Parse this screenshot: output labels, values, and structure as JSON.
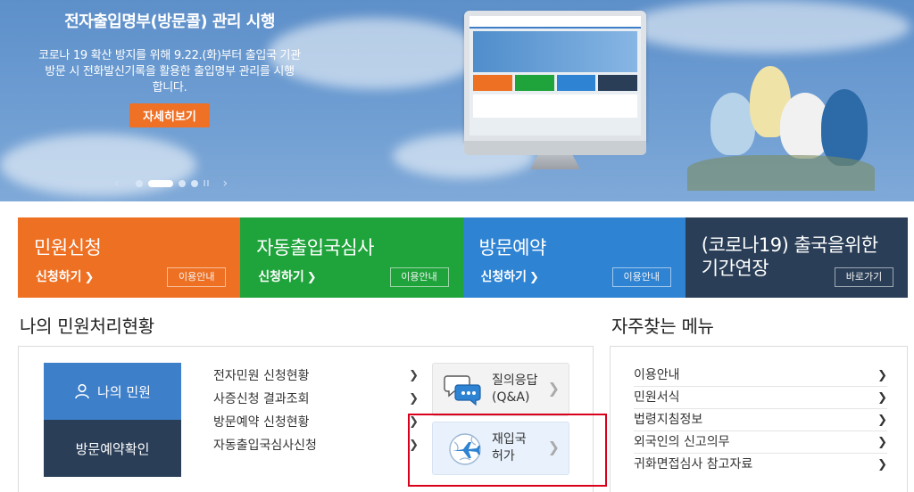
{
  "hero": {
    "title": "전자출입명부(방문콜) 관리 시행",
    "desc_line1": "코로나 19 확산 방지를 위해 9.22.(화)부터 출입국 기관",
    "desc_line2": "방문 시 전화발신기록을 활용한 출입명부 관리를 시행",
    "desc_line3": "합니다.",
    "button_label": "자세히보기",
    "prev": "‹",
    "next": "›",
    "pause": "II"
  },
  "cards": [
    {
      "title": "민원신청",
      "link": "신청하기",
      "button": "이용안내",
      "color": "#ee7023"
    },
    {
      "title": "자동출입국심사",
      "link": "신청하기",
      "button": "이용안내",
      "color": "#1fa33b"
    },
    {
      "title": "방문예약",
      "link": "신청하기",
      "button": "이용안내",
      "color": "#2f83d3"
    },
    {
      "title_line1": "(코로나19) 출국을위한",
      "title_line2": "기간연장",
      "button": "바로가기",
      "color": "#2a3e57"
    }
  ],
  "status_section": {
    "title": "나의 민원처리현황",
    "my_button": "나의 민원",
    "visit_button": "방문예약확인",
    "list": [
      "전자민원 신청현황",
      "사증신청 결과조회",
      "방문예약 신청현황",
      "자동출입국심사신청"
    ],
    "qa_label_line1": "질의응답",
    "qa_label_line2": "(Q&A)",
    "reentry_label_line1": "재입국",
    "reentry_label_line2": "허가"
  },
  "freq_section": {
    "title": "자주찾는 메뉴",
    "items": [
      "이용안내",
      "민원서식",
      "법령지침정보",
      "외국인의 신고의무",
      "귀화면접심사 참고자료"
    ]
  },
  "colors": {
    "orange": "#ee7023",
    "green": "#1fa33b",
    "blue": "#2f83d3",
    "navy": "#2a3e57",
    "highlight": "#d9001b"
  }
}
